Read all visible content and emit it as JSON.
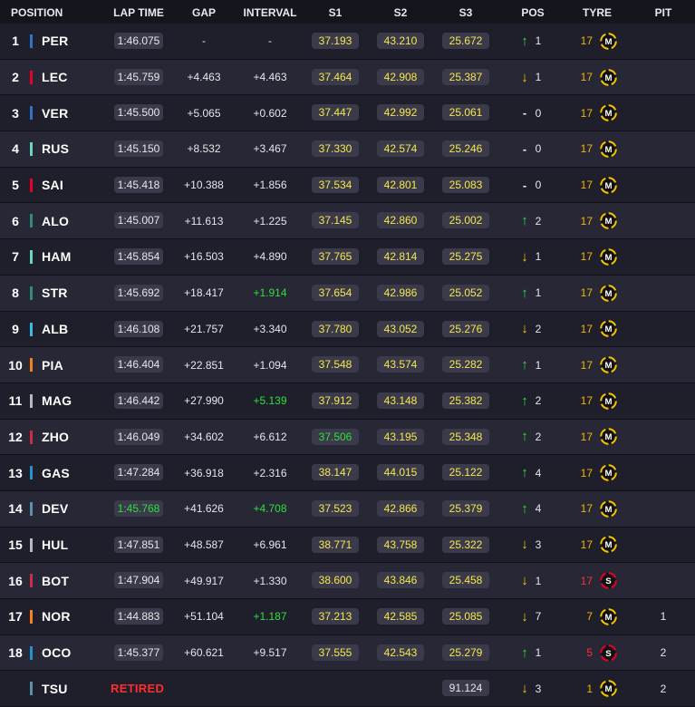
{
  "headers": {
    "position": "POSITION",
    "lap_time": "LAP TIME",
    "gap": "GAP",
    "interval": "INTERVAL",
    "s1": "S1",
    "s2": "S2",
    "s3": "S3",
    "pos": "POS",
    "tyre": "TYRE",
    "pit": "PIT"
  },
  "colors": {
    "red_bull": "#3671c6",
    "ferrari": "#e8002d",
    "mercedes": "#6cd3bf",
    "alpine": "#2293d1",
    "aston": "#358c75",
    "williams": "#37bedd",
    "mclaren": "#f58020",
    "haas": "#b6babd",
    "alfa": "#c92d4b",
    "alphatauri": "#5e8faa",
    "medium_tyre": "#f5c400",
    "soft_tyre": "#e8002d"
  },
  "rows": [
    {
      "pos": "1",
      "team": "red_bull",
      "driver": "PER",
      "lap": "1:46.075",
      "lap_best": false,
      "gap": "-",
      "interval": "-",
      "interval_fast": false,
      "s1": "37.193",
      "s1_best": false,
      "s2": "43.210",
      "s3": "25.672",
      "s3_plain": false,
      "dir": "up",
      "dir_icon": "↑",
      "pos_change": "1",
      "laps": "17",
      "laps_red": false,
      "tyre": "M",
      "tyre_icon": "medium-tyre-icon",
      "pit": ""
    },
    {
      "pos": "2",
      "team": "ferrari",
      "driver": "LEC",
      "lap": "1:45.759",
      "lap_best": false,
      "gap": "+4.463",
      "interval": "+4.463",
      "interval_fast": false,
      "s1": "37.464",
      "s1_best": false,
      "s2": "42.908",
      "s3": "25.387",
      "s3_plain": false,
      "dir": "down",
      "dir_icon": "↓",
      "pos_change": "1",
      "laps": "17",
      "laps_red": false,
      "tyre": "M",
      "tyre_icon": "medium-tyre-icon",
      "pit": ""
    },
    {
      "pos": "3",
      "team": "red_bull",
      "driver": "VER",
      "lap": "1:45.500",
      "lap_best": false,
      "gap": "+5.065",
      "interval": "+0.602",
      "interval_fast": false,
      "s1": "37.447",
      "s1_best": false,
      "s2": "42.992",
      "s3": "25.061",
      "s3_plain": false,
      "dir": "same",
      "dir_icon": "-",
      "pos_change": "0",
      "laps": "17",
      "laps_red": false,
      "tyre": "M",
      "tyre_icon": "medium-tyre-icon",
      "pit": ""
    },
    {
      "pos": "4",
      "team": "mercedes",
      "driver": "RUS",
      "lap": "1:45.150",
      "lap_best": false,
      "gap": "+8.532",
      "interval": "+3.467",
      "interval_fast": false,
      "s1": "37.330",
      "s1_best": false,
      "s2": "42.574",
      "s3": "25.246",
      "s3_plain": false,
      "dir": "same",
      "dir_icon": "-",
      "pos_change": "0",
      "laps": "17",
      "laps_red": false,
      "tyre": "M",
      "tyre_icon": "medium-tyre-icon",
      "pit": ""
    },
    {
      "pos": "5",
      "team": "ferrari",
      "driver": "SAI",
      "lap": "1:45.418",
      "lap_best": false,
      "gap": "+10.388",
      "interval": "+1.856",
      "interval_fast": false,
      "s1": "37.534",
      "s1_best": false,
      "s2": "42.801",
      "s3": "25.083",
      "s3_plain": false,
      "dir": "same",
      "dir_icon": "-",
      "pos_change": "0",
      "laps": "17",
      "laps_red": false,
      "tyre": "M",
      "tyre_icon": "medium-tyre-icon",
      "pit": ""
    },
    {
      "pos": "6",
      "team": "aston",
      "driver": "ALO",
      "lap": "1:45.007",
      "lap_best": false,
      "gap": "+11.613",
      "interval": "+1.225",
      "interval_fast": false,
      "s1": "37.145",
      "s1_best": false,
      "s2": "42.860",
      "s3": "25.002",
      "s3_plain": false,
      "dir": "up",
      "dir_icon": "↑",
      "pos_change": "2",
      "laps": "17",
      "laps_red": false,
      "tyre": "M",
      "tyre_icon": "medium-tyre-icon",
      "pit": ""
    },
    {
      "pos": "7",
      "team": "mercedes",
      "driver": "HAM",
      "lap": "1:45.854",
      "lap_best": false,
      "gap": "+16.503",
      "interval": "+4.890",
      "interval_fast": false,
      "s1": "37.765",
      "s1_best": false,
      "s2": "42.814",
      "s3": "25.275",
      "s3_plain": false,
      "dir": "down",
      "dir_icon": "↓",
      "pos_change": "1",
      "laps": "17",
      "laps_red": false,
      "tyre": "M",
      "tyre_icon": "medium-tyre-icon",
      "pit": ""
    },
    {
      "pos": "8",
      "team": "aston",
      "driver": "STR",
      "lap": "1:45.692",
      "lap_best": false,
      "gap": "+18.417",
      "interval": "+1.914",
      "interval_fast": true,
      "s1": "37.654",
      "s1_best": false,
      "s2": "42.986",
      "s3": "25.052",
      "s3_plain": false,
      "dir": "up",
      "dir_icon": "↑",
      "pos_change": "1",
      "laps": "17",
      "laps_red": false,
      "tyre": "M",
      "tyre_icon": "medium-tyre-icon",
      "pit": ""
    },
    {
      "pos": "9",
      "team": "williams",
      "driver": "ALB",
      "lap": "1:46.108",
      "lap_best": false,
      "gap": "+21.757",
      "interval": "+3.340",
      "interval_fast": false,
      "s1": "37.780",
      "s1_best": false,
      "s2": "43.052",
      "s3": "25.276",
      "s3_plain": false,
      "dir": "down",
      "dir_icon": "↓",
      "pos_change": "2",
      "laps": "17",
      "laps_red": false,
      "tyre": "M",
      "tyre_icon": "medium-tyre-icon",
      "pit": ""
    },
    {
      "pos": "10",
      "team": "mclaren",
      "driver": "PIA",
      "lap": "1:46.404",
      "lap_best": false,
      "gap": "+22.851",
      "interval": "+1.094",
      "interval_fast": false,
      "s1": "37.548",
      "s1_best": false,
      "s2": "43.574",
      "s3": "25.282",
      "s3_plain": false,
      "dir": "up",
      "dir_icon": "↑",
      "pos_change": "1",
      "laps": "17",
      "laps_red": false,
      "tyre": "M",
      "tyre_icon": "medium-tyre-icon",
      "pit": ""
    },
    {
      "pos": "11",
      "team": "haas",
      "driver": "MAG",
      "lap": "1:46.442",
      "lap_best": false,
      "gap": "+27.990",
      "interval": "+5.139",
      "interval_fast": true,
      "s1": "37.912",
      "s1_best": false,
      "s2": "43.148",
      "s3": "25.382",
      "s3_plain": false,
      "dir": "up",
      "dir_icon": "↑",
      "pos_change": "2",
      "laps": "17",
      "laps_red": false,
      "tyre": "M",
      "tyre_icon": "medium-tyre-icon",
      "pit": ""
    },
    {
      "pos": "12",
      "team": "alfa",
      "driver": "ZHO",
      "lap": "1:46.049",
      "lap_best": false,
      "gap": "+34.602",
      "interval": "+6.612",
      "interval_fast": false,
      "s1": "37.506",
      "s1_best": true,
      "s2": "43.195",
      "s3": "25.348",
      "s3_plain": false,
      "dir": "up",
      "dir_icon": "↑",
      "pos_change": "2",
      "laps": "17",
      "laps_red": false,
      "tyre": "M",
      "tyre_icon": "medium-tyre-icon",
      "pit": ""
    },
    {
      "pos": "13",
      "team": "alpine",
      "driver": "GAS",
      "lap": "1:47.284",
      "lap_best": false,
      "gap": "+36.918",
      "interval": "+2.316",
      "interval_fast": false,
      "s1": "38.147",
      "s1_best": false,
      "s2": "44.015",
      "s3": "25.122",
      "s3_plain": false,
      "dir": "up",
      "dir_icon": "↑",
      "pos_change": "4",
      "laps": "17",
      "laps_red": false,
      "tyre": "M",
      "tyre_icon": "medium-tyre-icon",
      "pit": ""
    },
    {
      "pos": "14",
      "team": "alphatauri",
      "driver": "DEV",
      "lap": "1:45.768",
      "lap_best": true,
      "gap": "+41.626",
      "interval": "+4.708",
      "interval_fast": true,
      "s1": "37.523",
      "s1_best": false,
      "s2": "42.866",
      "s3": "25.379",
      "s3_plain": false,
      "dir": "up",
      "dir_icon": "↑",
      "pos_change": "4",
      "laps": "17",
      "laps_red": false,
      "tyre": "M",
      "tyre_icon": "medium-tyre-icon",
      "pit": ""
    },
    {
      "pos": "15",
      "team": "haas",
      "driver": "HUL",
      "lap": "1:47.851",
      "lap_best": false,
      "gap": "+48.587",
      "interval": "+6.961",
      "interval_fast": false,
      "s1": "38.771",
      "s1_best": false,
      "s2": "43.758",
      "s3": "25.322",
      "s3_plain": false,
      "dir": "down",
      "dir_icon": "↓",
      "pos_change": "3",
      "laps": "17",
      "laps_red": false,
      "tyre": "M",
      "tyre_icon": "medium-tyre-icon",
      "pit": ""
    },
    {
      "pos": "16",
      "team": "alfa",
      "driver": "BOT",
      "lap": "1:47.904",
      "lap_best": false,
      "gap": "+49.917",
      "interval": "+1.330",
      "interval_fast": false,
      "s1": "38.600",
      "s1_best": false,
      "s2": "43.846",
      "s3": "25.458",
      "s3_plain": false,
      "dir": "down",
      "dir_icon": "↓",
      "pos_change": "1",
      "laps": "17",
      "laps_red": true,
      "tyre": "S",
      "tyre_icon": "soft-tyre-icon",
      "pit": ""
    },
    {
      "pos": "17",
      "team": "mclaren",
      "driver": "NOR",
      "lap": "1:44.883",
      "lap_best": false,
      "gap": "+51.104",
      "interval": "+1.187",
      "interval_fast": true,
      "s1": "37.213",
      "s1_best": false,
      "s2": "42.585",
      "s3": "25.085",
      "s3_plain": false,
      "dir": "down",
      "dir_icon": "↓",
      "pos_change": "7",
      "laps": "7",
      "laps_red": false,
      "tyre": "M",
      "tyre_icon": "medium-tyre-icon",
      "pit": "1"
    },
    {
      "pos": "18",
      "team": "alpine",
      "driver": "OCO",
      "lap": "1:45.377",
      "lap_best": false,
      "gap": "+60.621",
      "interval": "+9.517",
      "interval_fast": false,
      "s1": "37.555",
      "s1_best": false,
      "s2": "42.543",
      "s3": "25.279",
      "s3_plain": false,
      "dir": "up",
      "dir_icon": "↑",
      "pos_change": "1",
      "laps": "5",
      "laps_red": true,
      "tyre": "S",
      "tyre_icon": "soft-tyre-icon",
      "pit": "2"
    },
    {
      "pos": "",
      "team": "alphatauri",
      "driver": "TSU",
      "retired": "RETIRED",
      "lap": "",
      "lap_best": false,
      "gap": "",
      "interval": "",
      "interval_fast": false,
      "s1": "",
      "s1_best": false,
      "s2": "",
      "s3": "91.124",
      "s3_plain": true,
      "dir": "down",
      "dir_icon": "↓",
      "pos_change": "3",
      "laps": "1",
      "laps_red": false,
      "tyre": "M",
      "tyre_icon": "medium-tyre-icon",
      "pit": "2"
    }
  ]
}
